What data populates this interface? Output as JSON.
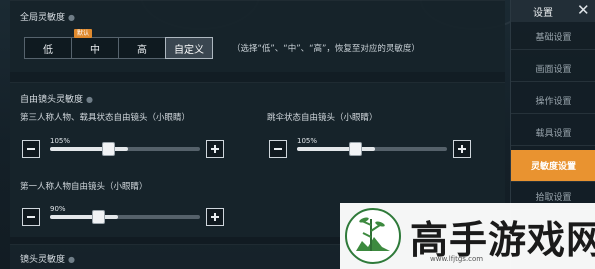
{
  "sections": {
    "global": {
      "title": "全局灵敏度",
      "buttons": [
        {
          "label": "低"
        },
        {
          "label": "中",
          "badge": "默认"
        },
        {
          "label": "高"
        },
        {
          "label": "自定义",
          "active": true
        }
      ],
      "hint": "（选择“低”、“中”、“高”，恢复至对应的灵敏度）"
    },
    "free_cam": {
      "title": "自由镜头灵敏度",
      "sliders": [
        {
          "label": "第三人称人物、载具状态自由镜头（小眼睛）",
          "value_text": "105%",
          "fill": 0.52
        },
        {
          "label": "跳伞状态自由镜头（小眼睛）",
          "value_text": "105%",
          "fill": 0.52
        },
        {
          "label": "第一人称人物自由镜头（小眼睛）",
          "value_text": "90%",
          "fill": 0.45
        }
      ]
    },
    "lens": {
      "title": "镜头灵敏度"
    }
  },
  "sidebar": {
    "title": "设置",
    "close": "✕",
    "items": [
      {
        "label": "基础设置"
      },
      {
        "label": "画面设置"
      },
      {
        "label": "操作设置"
      },
      {
        "label": "载具设置"
      },
      {
        "label": "灵敏度设置",
        "active": true
      },
      {
        "label": "拾取设置"
      }
    ]
  },
  "watermark": {
    "text": "高手游戏网",
    "url": "www.lfjtgs.com"
  },
  "colors": {
    "accent": "#e99330",
    "badge": "#e08a2e"
  }
}
